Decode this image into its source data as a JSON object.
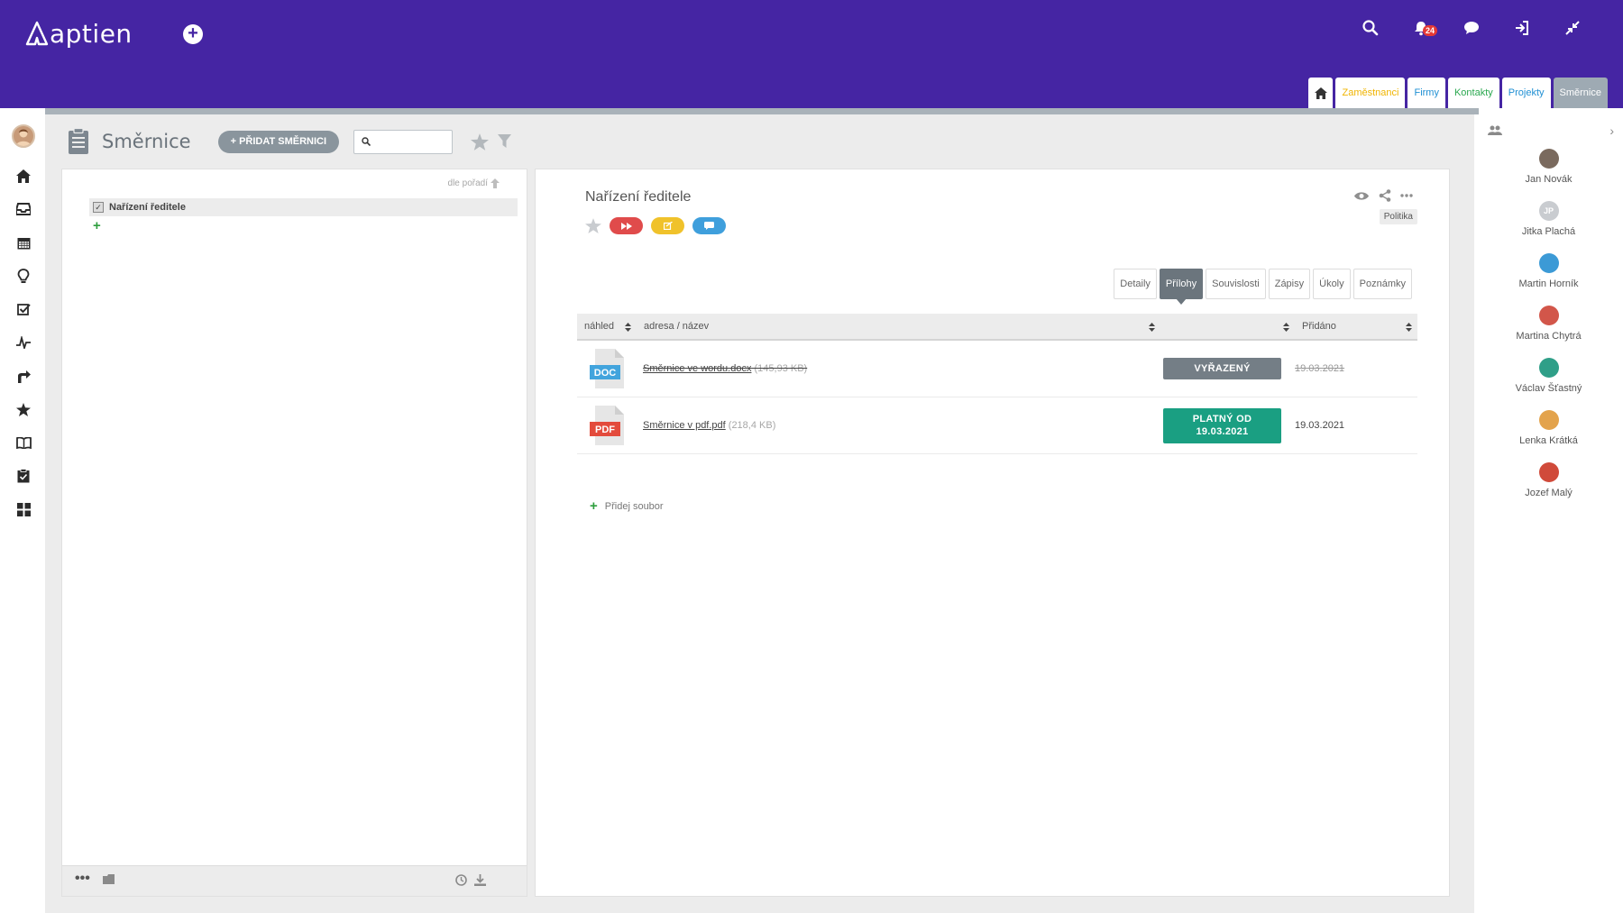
{
  "app": {
    "logo_text": "aptien",
    "notification_count": "24",
    "accent_color": "#4525a3"
  },
  "top_icons": [
    "search-icon",
    "bell-icon",
    "chat-icon",
    "logout-icon",
    "compress-icon"
  ],
  "module_tabs": [
    {
      "label": "Zaměstnanci",
      "color": "#f0b400"
    },
    {
      "label": "Firmy",
      "color": "#1f8fd3"
    },
    {
      "label": "Kontakty",
      "color": "#2aa84f"
    },
    {
      "label": "Projekty",
      "color": "#1f8fd3"
    },
    {
      "label": "Směrnice",
      "color": "#ffffff"
    }
  ],
  "nav": [
    "home-icon",
    "inbox-icon",
    "calendar-icon",
    "bulb-icon",
    "checklist-icon",
    "pulse-icon",
    "directions-icon",
    "star-icon",
    "book-icon",
    "clipboard-icon",
    "grid-icon"
  ],
  "page": {
    "title": "Směrnice",
    "add_button": "+ PŘIDAT SMĚRNICI",
    "search_placeholder": ""
  },
  "tree": {
    "sort_label": "dle pořadí",
    "items": [
      {
        "label": "Nařízení ředitele"
      }
    ]
  },
  "detail": {
    "title": "Nařízení ředitele",
    "category": "Politika",
    "tabs": [
      "Detaily",
      "Přílohy",
      "Souvislosti",
      "Zápisy",
      "Úkoly",
      "Poznámky"
    ],
    "active_tab": "Přílohy",
    "columns": [
      "náhled",
      "adresa / název",
      "",
      "Přidáno"
    ],
    "attachments": [
      {
        "type": "DOC",
        "name": "Směrnice ve wordu.docx",
        "size": "(145,93 KB)",
        "status": "VYŘAZENÝ",
        "added": "19.03.2021",
        "retired": true
      },
      {
        "type": "PDF",
        "name": "Směrnice v pdf.pdf",
        "size": "(218,4 KB)",
        "status_line1": "PLATNÝ OD",
        "status_line2": "19.03.2021",
        "added": "19.03.2021",
        "retired": false
      }
    ],
    "add_file": "Přidej soubor"
  },
  "people": [
    {
      "name": "Jan Novák",
      "initials": "",
      "color": "#7a6a5e"
    },
    {
      "name": "Jitka Plachá",
      "initials": "JP",
      "color": "#c9ccd0"
    },
    {
      "name": "Martin Horník",
      "initials": "",
      "color": "#3c9ad6"
    },
    {
      "name": "Martina Chytrá",
      "initials": "",
      "color": "#d2564a"
    },
    {
      "name": "Václav Šťastný",
      "initials": "",
      "color": "#2f9f88"
    },
    {
      "name": "Lenka Krátká",
      "initials": "",
      "color": "#e3a34c"
    },
    {
      "name": "Jozef Malý",
      "initials": "",
      "color": "#d04a3a"
    }
  ]
}
